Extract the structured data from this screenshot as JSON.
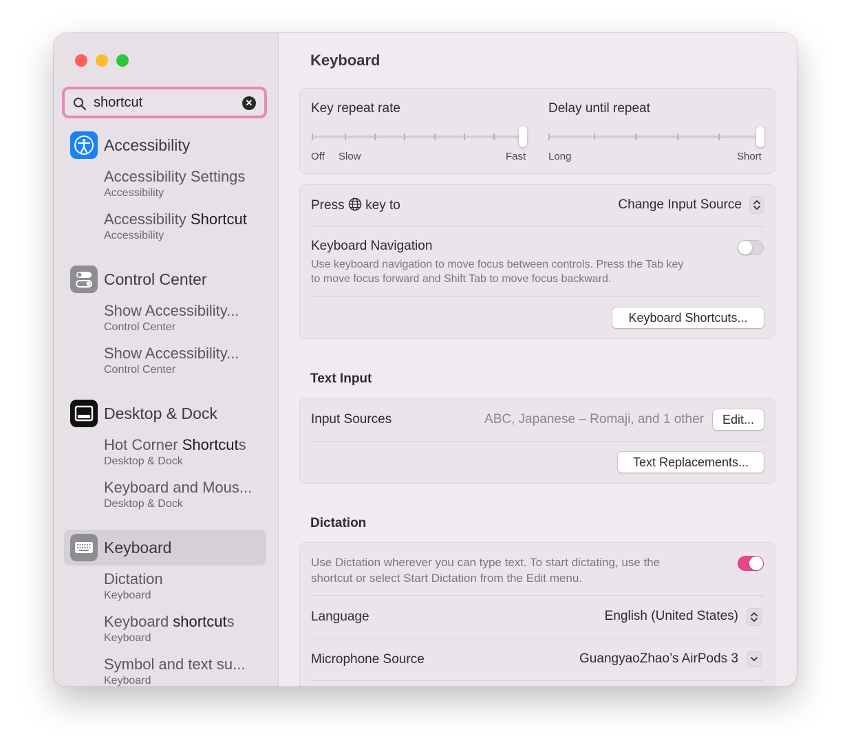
{
  "search": {
    "value": "shortcut",
    "clear": "✕"
  },
  "sidebar": {
    "categories": [
      {
        "label": "Accessibility",
        "icon": "accessibility-icon",
        "color": "#1a82f7"
      },
      {
        "label": "Control Center",
        "icon": "control-center-icon",
        "color": "#8e8d92"
      },
      {
        "label": "Desktop & Dock",
        "icon": "desktop-dock-icon",
        "color": "#111111"
      },
      {
        "label": "Keyboard",
        "icon": "keyboard-icon",
        "color": "#8e8d92"
      }
    ],
    "results": [
      {
        "pre": "Accessibility Settings",
        "match": "",
        "post": "",
        "sub": "Accessibility"
      },
      {
        "pre": "Accessibility ",
        "match": "Shortcut",
        "post": "",
        "sub": "Accessibility"
      },
      {
        "pre": "Show Accessibility...",
        "match": "",
        "post": "",
        "sub": "Control Center"
      },
      {
        "pre": "Show Accessibility...",
        "match": "",
        "post": "",
        "sub": "Control Center"
      },
      {
        "pre": "Hot Corner ",
        "match": "Shortcut",
        "post": "s",
        "sub": "Desktop & Dock"
      },
      {
        "pre": "Keyboard and Mous...",
        "match": "",
        "post": "",
        "sub": "Desktop & Dock"
      },
      {
        "pre": "Dictation",
        "match": "",
        "post": "",
        "sub": "Keyboard"
      },
      {
        "pre": "Keyboard ",
        "match": "shortcut",
        "post": "s",
        "sub": "Keyboard"
      },
      {
        "pre": "Symbol and text su...",
        "match": "",
        "post": "",
        "sub": "Keyboard"
      }
    ]
  },
  "main": {
    "title": "Keyboard",
    "key_repeat": {
      "label": "Key repeat rate",
      "off": "Off",
      "slow": "Slow",
      "fast": "Fast",
      "level": 1.0
    },
    "delay": {
      "label": "Delay until repeat",
      "long": "Long",
      "short": "Short",
      "level": 1.0
    },
    "press_key": {
      "pre": "Press",
      "post": "key to",
      "value": "Change Input Source"
    },
    "keyboard_nav": {
      "label": "Keyboard Navigation",
      "desc1": "Use keyboard navigation to move focus between controls. Press the Tab key",
      "desc2": "to move focus forward and Shift Tab to move focus backward.",
      "on": false
    },
    "keyboard_shortcuts_button": "Keyboard Shortcuts...",
    "text_input": {
      "title": "Text Input",
      "input_sources_label": "Input Sources",
      "input_sources_value": "ABC, Japanese – Romaji, and 1 other",
      "edit_button": "Edit...",
      "text_replacements_button": "Text Replacements..."
    },
    "dictation": {
      "title": "Dictation",
      "desc1": "Use Dictation wherever you can type text. To start dictating, use the",
      "desc2": "shortcut or select Start Dictation from the Edit menu.",
      "on": true,
      "language_label": "Language",
      "language_value": "English (United States)",
      "mic_label": "Microphone Source",
      "mic_value": "GuangyaoZhao’s AirPods 3"
    }
  },
  "colors": {
    "accent": "#e5478a",
    "search_ring": "#e58ab4"
  }
}
